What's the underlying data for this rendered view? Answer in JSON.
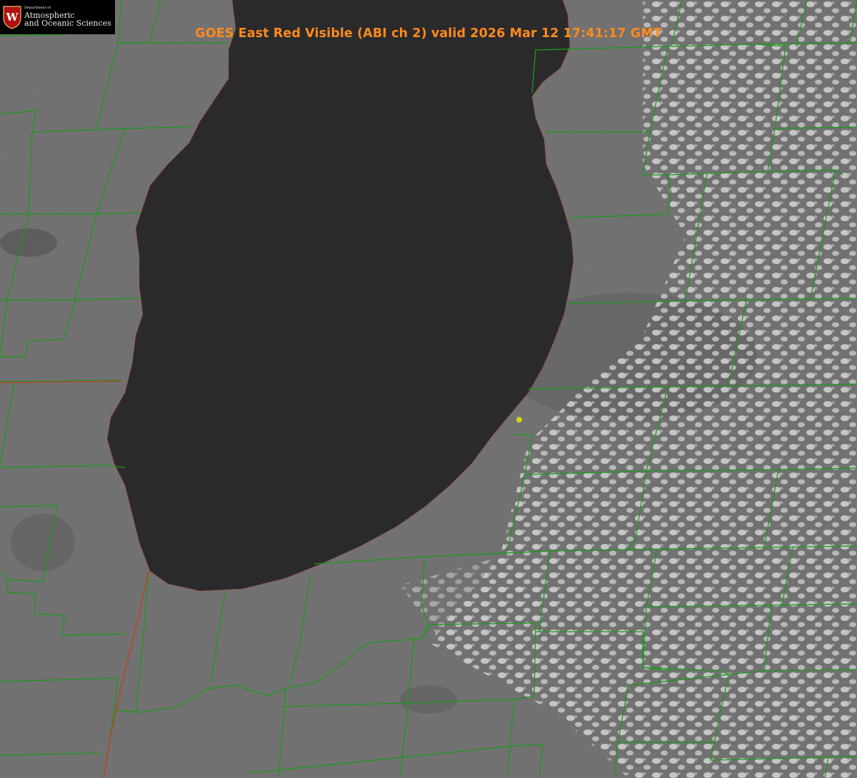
{
  "map": {
    "title": "GOES East Red Visible (ABI ch 2) valid 2026 Mar 12 17:41:17 GMT",
    "title_color": "#ff8a1c",
    "lake_color": "#2a2a2c",
    "land_color": "#6a6a6a",
    "boundary_color": "#1a9a1a",
    "state_line_color": "#c04020",
    "point_color": "#d4d21a"
  },
  "logo": {
    "dept": "Department of",
    "line1": "Atmospheric",
    "line2": "and Oceanic Sciences",
    "shield_letter": "W",
    "shield_color": "#b01010"
  }
}
